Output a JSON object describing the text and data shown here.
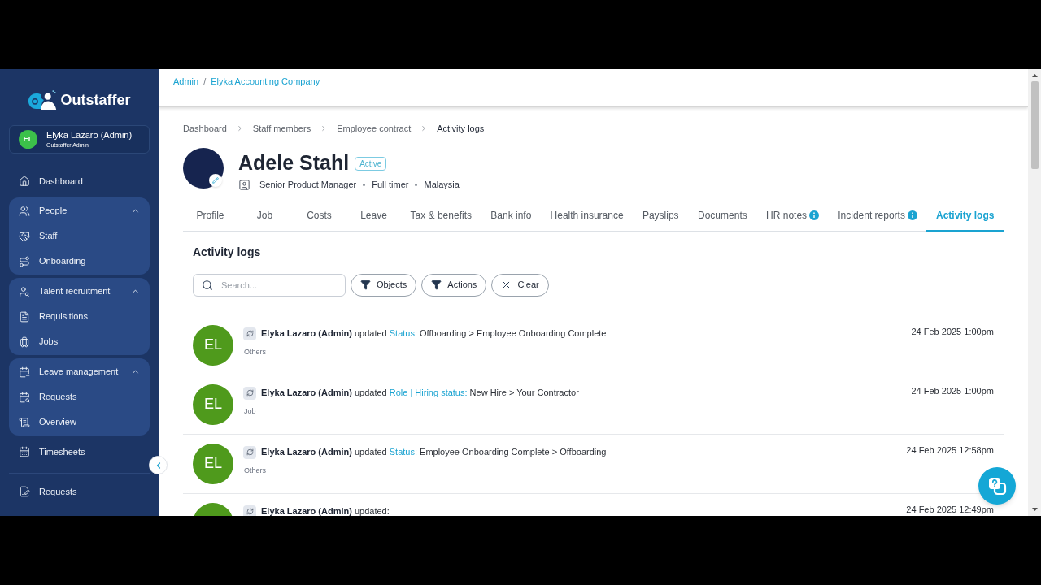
{
  "sidebar": {
    "logo": "Outstaffer",
    "user": {
      "initials": "EL",
      "name": "Elyka Lazaro (Admin)",
      "role": "Outstaffer Admin"
    },
    "nav": [
      {
        "kind": "link",
        "label": "Dashboard"
      },
      {
        "kind": "group",
        "label": "People",
        "expanded": true,
        "children": [
          {
            "label": "Staff"
          },
          {
            "label": "Onboarding"
          }
        ]
      },
      {
        "kind": "group",
        "label": "Talent recruitment",
        "expanded": true,
        "children": [
          {
            "label": "Requisitions"
          },
          {
            "label": "Jobs"
          }
        ]
      },
      {
        "kind": "group",
        "label": "Leave management",
        "expanded": true,
        "children": [
          {
            "label": "Requests"
          },
          {
            "label": "Overview"
          }
        ]
      },
      {
        "kind": "link",
        "label": "Timesheets"
      }
    ],
    "secondary_nav": [
      {
        "label": "Requests"
      }
    ]
  },
  "header": {
    "breadcrumbs": [
      {
        "label": "Admin"
      },
      {
        "label": "Elyka Accounting Company"
      }
    ],
    "separator": "/"
  },
  "page": {
    "breadcrumbs": [
      {
        "label": "Dashboard",
        "current": false
      },
      {
        "label": "Staff members",
        "current": false
      },
      {
        "label": "Employee contract",
        "current": false
      },
      {
        "label": "Activity logs",
        "current": true
      }
    ]
  },
  "profile": {
    "name": "Adele Stahl",
    "status": "Active",
    "details": [
      "Senior Product Manager",
      "Full timer",
      "Malaysia"
    ]
  },
  "tabs": [
    {
      "label": "Profile",
      "selected": false,
      "info": false
    },
    {
      "label": "Job",
      "selected": false,
      "info": false
    },
    {
      "label": "Costs",
      "selected": false,
      "info": false
    },
    {
      "label": "Leave",
      "selected": false,
      "info": false
    },
    {
      "label": "Tax & benefits",
      "selected": false,
      "info": false
    },
    {
      "label": "Bank info",
      "selected": false,
      "info": false
    },
    {
      "label": "Health insurance",
      "selected": false,
      "info": false
    },
    {
      "label": "Payslips",
      "selected": false,
      "info": false
    },
    {
      "label": "Documents",
      "selected": false,
      "info": false
    },
    {
      "label": "HR notes",
      "selected": false,
      "info": true
    },
    {
      "label": "Incident reports",
      "selected": false,
      "info": true
    },
    {
      "label": "Activity logs",
      "selected": true,
      "info": false
    }
  ],
  "activity": {
    "title": "Activity logs",
    "search": {
      "placeholder": "Search..."
    },
    "filters": [
      {
        "kind": "filter",
        "label": "Objects"
      },
      {
        "kind": "filter",
        "label": "Actions"
      },
      {
        "kind": "clear",
        "label": "Clear"
      }
    ],
    "entries": [
      {
        "initials": "EL",
        "actor": "Elyka Lazaro (Admin)",
        "verb": "updated",
        "field": "Status:",
        "change": "Offboarding > Employee Onboarding Complete",
        "category": "Others",
        "time": "24 Feb 2025 1:00pm"
      },
      {
        "initials": "EL",
        "actor": "Elyka Lazaro (Admin)",
        "verb": "updated",
        "field": "Role | Hiring status:",
        "change": "New Hire > Your Contractor",
        "category": "Job",
        "time": "24 Feb 2025 1:00pm"
      },
      {
        "initials": "EL",
        "actor": "Elyka Lazaro (Admin)",
        "verb": "updated",
        "field": "Status:",
        "change": "Employee Onboarding Complete > Offboarding",
        "category": "Others",
        "time": "24 Feb 2025 12:58pm"
      },
      {
        "actor": "Elyka Lazaro (Admin)",
        "verb": "updated:",
        "time": "24 Feb 2025 12:49pm"
      }
    ]
  }
}
